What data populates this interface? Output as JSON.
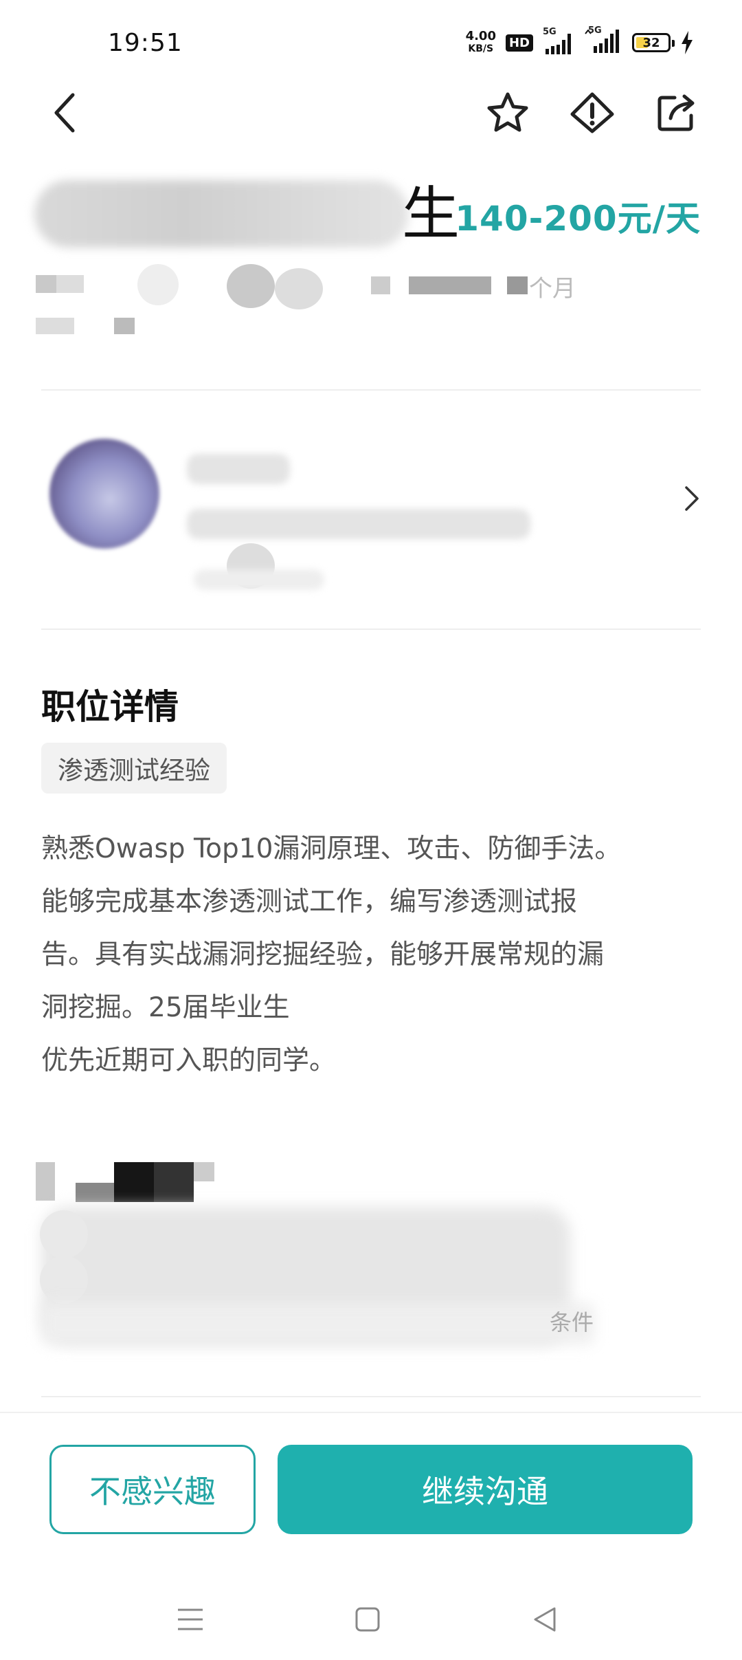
{
  "status_bar": {
    "time": "19:51",
    "net_speed_value": "4.00",
    "net_speed_unit": "KB/S",
    "hd_label": "HD",
    "signal_1": "5G",
    "signal_2": "5G",
    "battery_level": "32"
  },
  "nav": {
    "icons": [
      "back-icon",
      "star-icon",
      "report-icon",
      "share-icon"
    ]
  },
  "job": {
    "title_visible_tail": "生",
    "salary": "140-200元/天",
    "meta_visible_fragment": "个月"
  },
  "details": {
    "section_title": "职位详情",
    "tag": "渗透测试经验",
    "description": "熟悉Owasp Top10漏洞原理、攻击、防御手法。\n能够完成基本渗透测试工作，编写渗透测试报\n告。具有实战漏洞挖掘经验，能够开展常规的漏\n洞挖掘。25届毕业生\n优先近期可入职的同学。"
  },
  "lower_section": {
    "visible_fragment": "条件"
  },
  "actions": {
    "not_interested_label": "不感兴趣",
    "continue_chat_label": "继续沟通"
  },
  "colors": {
    "accent": "#23a5a4",
    "primary_button": "#1fb0ae"
  }
}
